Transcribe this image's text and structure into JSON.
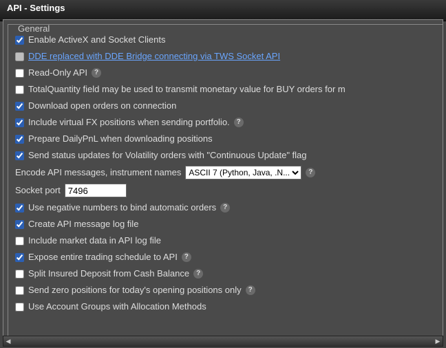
{
  "window": {
    "title": "API - Settings"
  },
  "group": {
    "label": "General"
  },
  "rows": {
    "enable_activex": {
      "checked": true,
      "label": "Enable ActiveX and Socket Clients"
    },
    "dde_bridge": {
      "checked": false,
      "label": "DDE replaced with DDE Bridge connecting via TWS Socket API"
    },
    "read_only": {
      "checked": false,
      "label": "Read-Only API"
    },
    "total_qty": {
      "checked": false,
      "label": "TotalQuantity field may be used to transmit monetary value for BUY orders for m"
    },
    "download_open": {
      "checked": true,
      "label": "Download open orders on connection"
    },
    "include_fx": {
      "checked": true,
      "label": "Include virtual FX positions when sending portfolio."
    },
    "prepare_pnl": {
      "checked": true,
      "label": "Prepare DailyPnL when downloading positions"
    },
    "vol_status": {
      "checked": true,
      "label": "Send status updates for Volatility orders with \"Continuous Update\" flag"
    },
    "encode_label": "Encode API messages, instrument names",
    "encode_value": "ASCII 7 (Python, Java, .N...",
    "socket_port_label": "Socket port",
    "socket_port_value": "7496",
    "neg_numbers": {
      "checked": true,
      "label": "Use negative numbers to bind automatic orders"
    },
    "msg_log": {
      "checked": true,
      "label": "Create API message log file"
    },
    "mkt_data_log": {
      "checked": false,
      "label": "Include market data in API log file"
    },
    "expose_sched": {
      "checked": true,
      "label": "Expose entire trading schedule to API"
    },
    "split_insured": {
      "checked": false,
      "label": "Split Insured Deposit from Cash Balance"
    },
    "zero_pos": {
      "checked": false,
      "label": "Send zero positions for today's opening positions only"
    },
    "acct_groups": {
      "checked": false,
      "label": "Use Account Groups with Allocation Methods"
    }
  },
  "help_glyph": "?"
}
